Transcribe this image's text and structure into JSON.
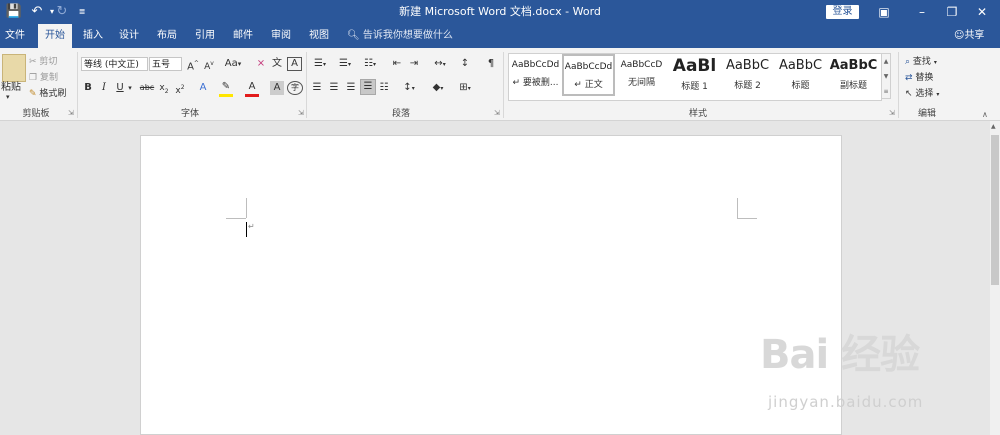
{
  "titlebar": {
    "title": "新建 Microsoft Word 文档.docx  -  Word",
    "login": "登录",
    "qat": {
      "save_icon": "save-icon",
      "undo_icon": "undo-icon",
      "redo_icon": "redo-icon",
      "customize_icon": "customize-icon"
    }
  },
  "tabs": [
    {
      "label": "文件"
    },
    {
      "label": "开始"
    },
    {
      "label": "插入"
    },
    {
      "label": "设计"
    },
    {
      "label": "布局"
    },
    {
      "label": "引用"
    },
    {
      "label": "邮件"
    },
    {
      "label": "审阅"
    },
    {
      "label": "视图"
    }
  ],
  "active_tab": "开始",
  "tell_me": "告诉我你想要做什么",
  "share": "共享",
  "ribbon": {
    "clipboard": {
      "label": "剪贴板",
      "paste": "粘贴",
      "cut": "剪切",
      "copy": "复制",
      "format_painter": "格式刷"
    },
    "font": {
      "label": "字体",
      "font_name": "等线 (中文正)",
      "font_size": "五号",
      "clear": "Aa"
    },
    "paragraph": {
      "label": "段落"
    },
    "styles": {
      "label": "样式",
      "items": [
        {
          "sample": "AaBbCcDd",
          "name": "↵ 要被删..."
        },
        {
          "sample": "AaBbCcDd",
          "name": "↵ 正文"
        },
        {
          "sample": "AaBbCcD",
          "name": "无间隔"
        },
        {
          "sample": "AaBl",
          "name": "标题 1"
        },
        {
          "sample": "AaBbC",
          "name": "标题 2"
        },
        {
          "sample": "AaBbC",
          "name": "标题"
        },
        {
          "sample": "AaBbC",
          "name": "副标题"
        }
      ]
    },
    "editing": {
      "label": "编辑",
      "find": "查找",
      "replace": "替换",
      "select": "选择"
    }
  },
  "document": {
    "paragraph_mark": "↵"
  },
  "watermark": {
    "main": "Bai 经验",
    "sub": "jingyan.baidu.com"
  }
}
